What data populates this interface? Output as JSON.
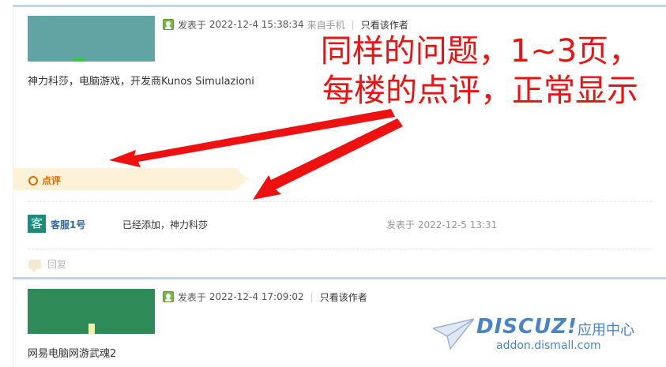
{
  "posts": [
    {
      "meta_prefix": "发表于",
      "datetime": "2022-12-4 15:38:34",
      "source": "来自手机",
      "only_author": "只看该作者",
      "content": "神力科莎，电脑游戏，开发商Kunos Simulazioni",
      "image_color": "#62a3a3"
    },
    {
      "meta_prefix": "发表于",
      "datetime": "2022-12-4 17:09:02",
      "only_author": "只看该作者",
      "content": "网易电脑网游武魂2",
      "image_color": "#2e8b57"
    }
  ],
  "annotation": {
    "line1": "同样的问题，1~3页，",
    "line2": "每楼的点评，正常显示",
    "color": "#ee1111"
  },
  "rating": {
    "label": "点评",
    "avatar_text": "客",
    "user": "客服1号",
    "text": "已经添加，神力科莎",
    "time": "发表于 2022-12-5 13:31"
  },
  "reply_label": "回复",
  "watermark": {
    "logo": "DISCUZ!",
    "cn": "应用中心",
    "url": "addon.dismall.com"
  }
}
